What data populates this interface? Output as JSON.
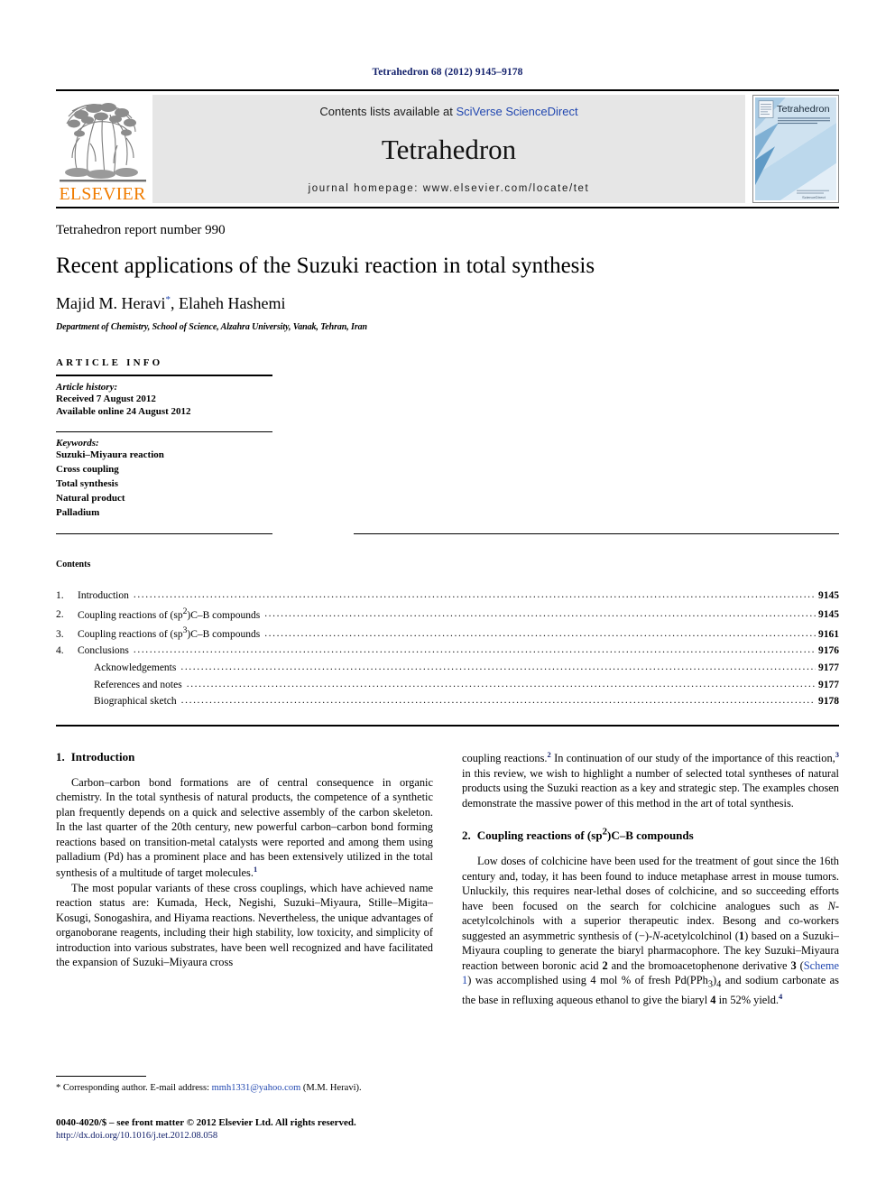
{
  "running_head": "Tetrahedron 68 (2012) 9145–9178",
  "masthead": {
    "publisher_name": "ELSEVIER",
    "contents_prefix": "Contents lists available at ",
    "contents_link": "SciVerse ScienceDirect",
    "journal_title": "Tetrahedron",
    "homepage": "journal homepage: www.elsevier.com/locate/tet",
    "cover_title": "Tetrahedron",
    "cover_subtitle": "The International Journal for the Rapid Publication of Full Original Research Papers and Critical Reviews in Organic Chemistry",
    "cover_footer": "ScienceDirect"
  },
  "title_block": {
    "report_number": "Tetrahedron report number 990",
    "title": "Recent applications of the Suzuki reaction in total synthesis",
    "authors": "Majid M. Heravi",
    "corresponding_marker": "*",
    "authors_rest": ", Elaheh Hashemi",
    "affiliation": "Department of Chemistry, School of Science, Alzahra University, Vanak, Tehran, Iran"
  },
  "article_info": {
    "heading": "ARTICLE INFO",
    "history_label": "Article history:",
    "received": "Received 7 August 2012",
    "available": "Available online 24 August 2012",
    "keywords_label": "Keywords:",
    "keywords": [
      "Suzuki–Miyaura reaction",
      "Cross coupling",
      "Total synthesis",
      "Natural product",
      "Palladium"
    ]
  },
  "contents": {
    "heading": "Contents",
    "entries": [
      {
        "num": "1.",
        "label": "Introduction",
        "page": "9145",
        "indent": false
      },
      {
        "num": "2.",
        "label": "Coupling reactions of (sp2)C–B compounds",
        "page": "9145",
        "indent": false,
        "sup": "2",
        "label_pre": "Coupling reactions of (sp",
        "label_post": ")C–B compounds"
      },
      {
        "num": "3.",
        "label": "Coupling reactions of (sp3)C–B compounds",
        "page": "9161",
        "indent": false,
        "sup": "3",
        "label_pre": "Coupling reactions of (sp",
        "label_post": ")C–B compounds"
      },
      {
        "num": "4.",
        "label": "Conclusions",
        "page": "9176",
        "indent": false
      },
      {
        "num": "",
        "label": "Acknowledgements",
        "page": "9177",
        "indent": true
      },
      {
        "num": "",
        "label": "References and notes",
        "page": "9177",
        "indent": true
      },
      {
        "num": "",
        "label": "Biographical sketch",
        "page": "9178",
        "indent": true
      }
    ]
  },
  "body": {
    "section1_num": "1.",
    "section1_title": "Introduction",
    "p1_a": "Carbon–carbon bond formations are of central consequence in organic chemistry. In the total synthesis of natural products, the competence of a synthetic plan frequently depends on a quick and selective assembly of the carbon skeleton. In the last quarter of the 20th century, new powerful carbon–carbon bond forming reactions based on transition-metal catalysts were reported and among them using palladium (Pd) has a prominent place and has been extensively utilized in the total synthesis of a multitude of target molecules.",
    "p1_sup": "1",
    "p2": "The most popular variants of these cross couplings, which have achieved name reaction status are: Kumada, Heck, Negishi, Suzuki–Miyaura, Stille–Migita–Kosugi, Sonogashira, and Hiyama reactions. Nevertheless, the unique advantages of organoborane reagents, including their high stability, low toxicity, and simplicity of introduction into various substrates, have been well recognized and have facilitated the expansion of Suzuki–Miyaura cross",
    "p3_a": "coupling reactions.",
    "p3_sup1": "2",
    "p3_b": " In continuation of our study of the importance of this reaction,",
    "p3_sup2": "3",
    "p3_c": " in this review, we wish to highlight a number of selected total syntheses of natural products using the Suzuki reaction as a key and strategic step. The examples chosen demonstrate the massive power of this method in the art of total synthesis.",
    "section2_num": "2.",
    "section2_title_pre": "Coupling reactions of (sp",
    "section2_title_sup": "2",
    "section2_title_post": ")C–B compounds",
    "p4_a": "Low doses of colchicine have been used for the treatment of gout since the 16th century and, today, it has been found to induce metaphase arrest in mouse tumors. Unluckily, this requires near-lethal doses of colchicine, and so succeeding efforts have been focused on the search for colchicine analogues such as ",
    "p4_italic1": "N",
    "p4_b": "-acetylcolchinols with a superior therapeutic index. Besong and co-workers suggested an asymmetric synthesis of (−)-",
    "p4_italic2": "N",
    "p4_c": "-acetylcolchinol (",
    "p4_bold1": "1",
    "p4_d": ") based on a Suzuki–Miyaura coupling to generate the biaryl pharmacophore. The key Suzuki–Miyaura reaction between boronic acid ",
    "p4_bold2": "2",
    "p4_e": " and the bromoacetophenone derivative ",
    "p4_bold3": "3",
    "p4_f": " (",
    "p4_link": "Scheme 1",
    "p4_g": ") was accomplished using 4 mol % of fresh Pd(PPh",
    "p4_sub1": "3",
    "p4_h": ")",
    "p4_sub2": "4",
    "p4_i": " and sodium carbonate as the base in refluxing aqueous ethanol to give the biaryl ",
    "p4_bold4": "4",
    "p4_j": " in 52% yield.",
    "p4_sup": "4"
  },
  "footer": {
    "corresponding_marker": "*",
    "corresponding_text": " Corresponding author. E-mail address: ",
    "corresponding_email": "mmh1331@yahoo.com",
    "corresponding_suffix": " (M.M. Heravi).",
    "copyright": "0040-4020/$ – see front matter © 2012 Elsevier Ltd. All rights reserved.",
    "doi": "http://dx.doi.org/10.1016/j.tet.2012.08.058"
  },
  "colors": {
    "link": "#2147b0",
    "running_head": "#12206b",
    "elsevier_orange": "#f07c00",
    "banner_bg": "#e6e6e6"
  }
}
